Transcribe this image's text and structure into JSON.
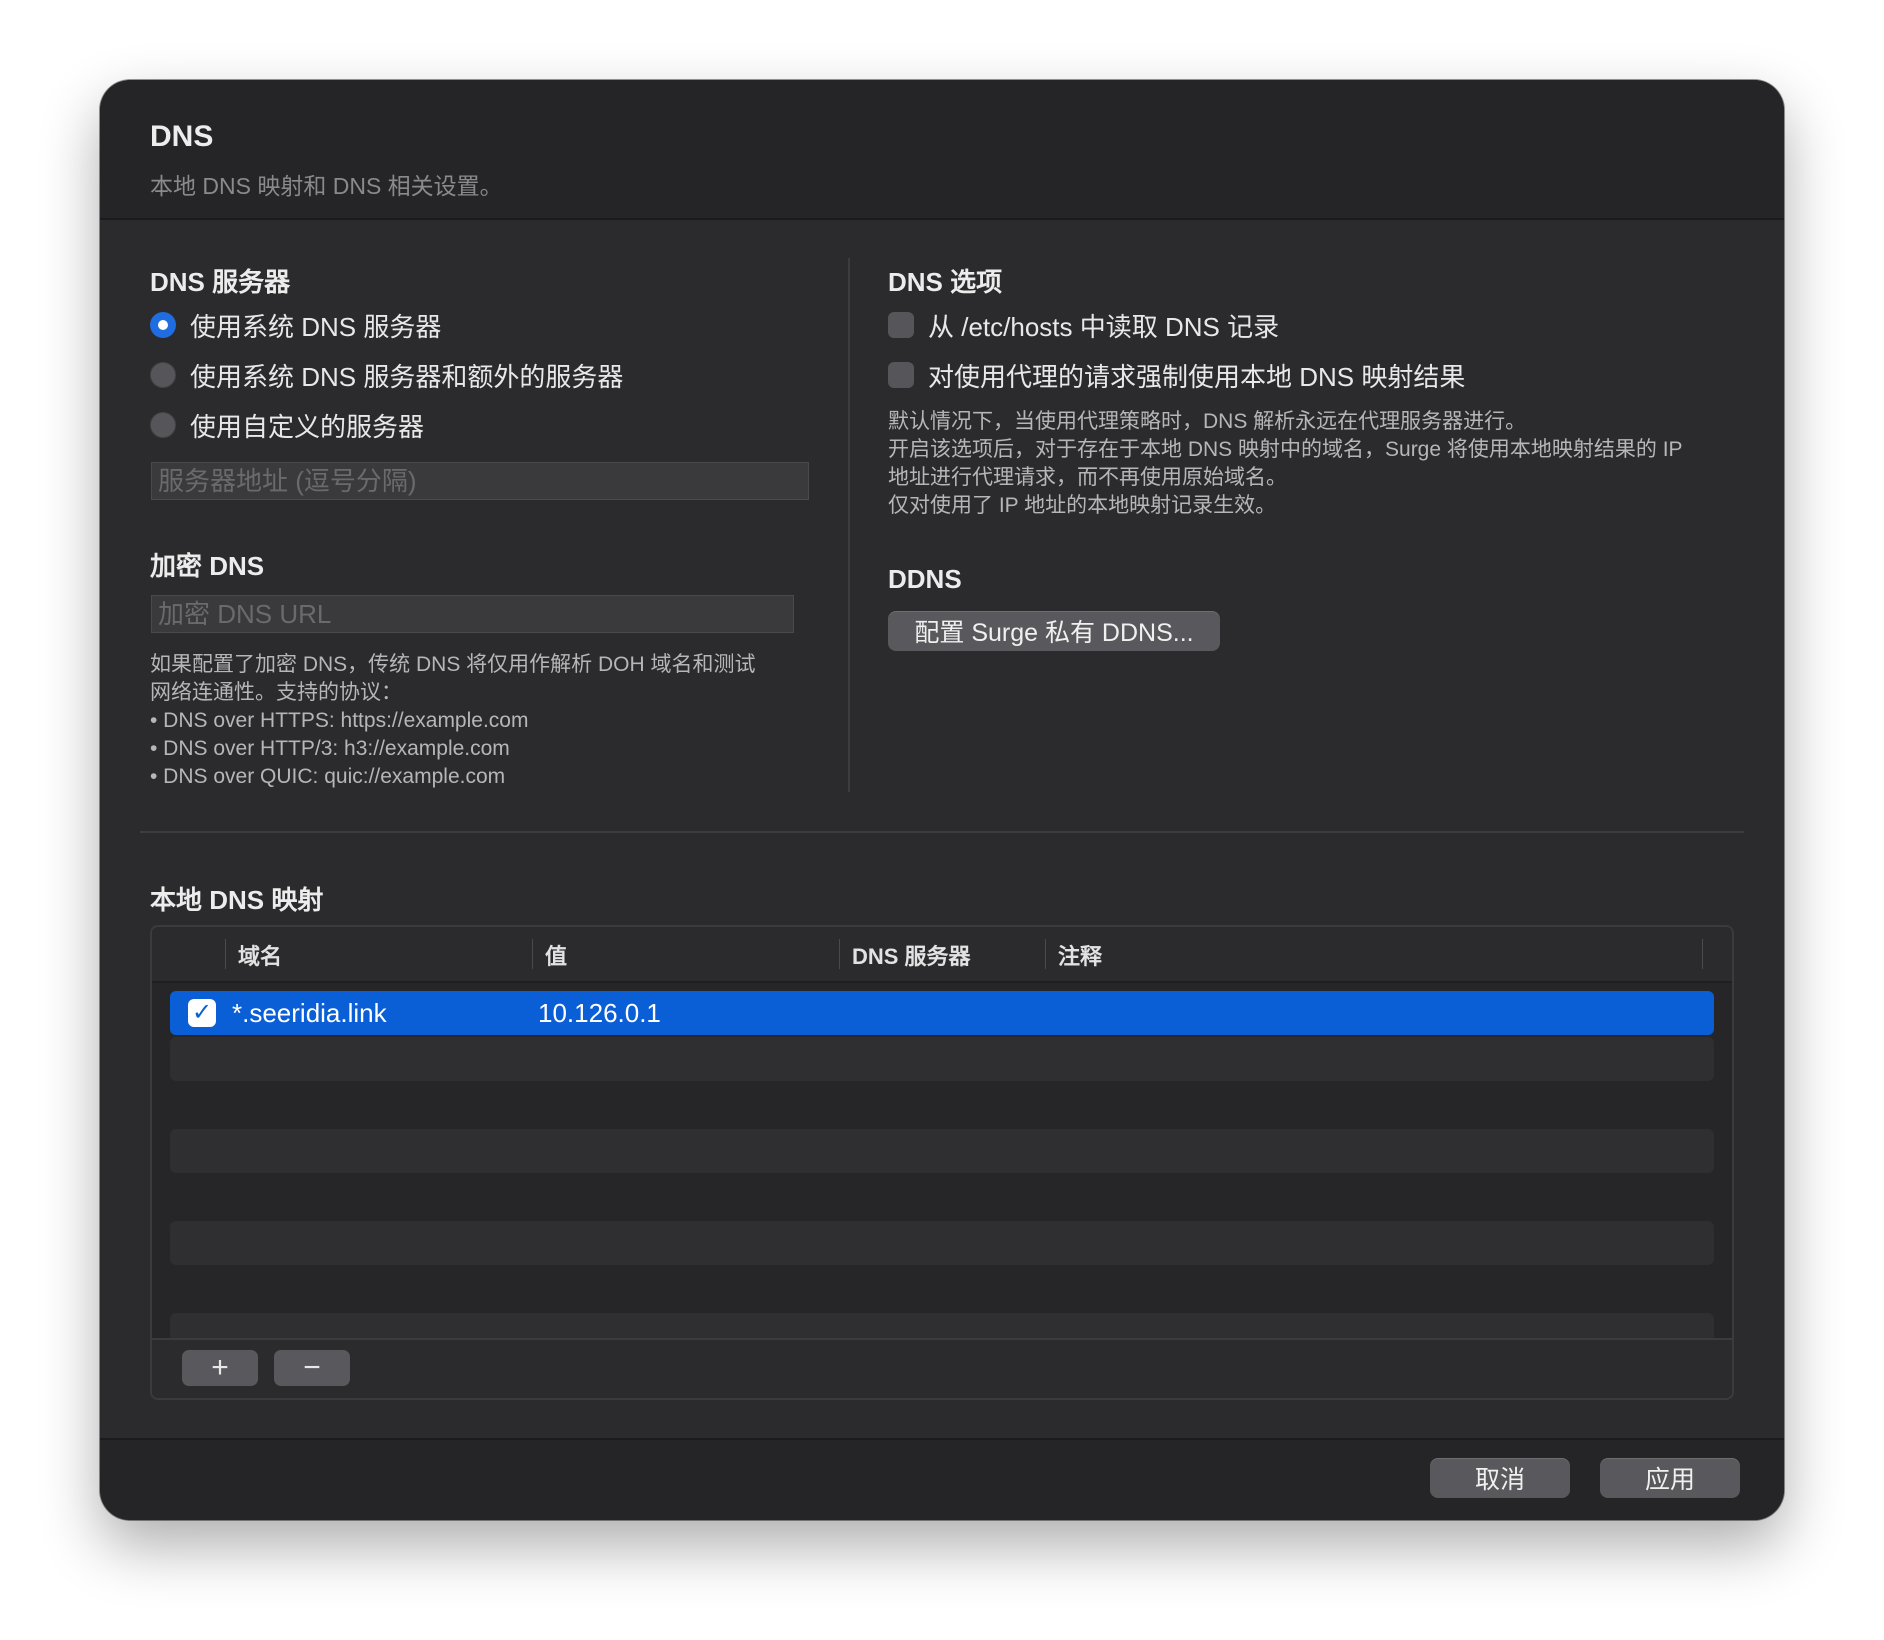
{
  "header": {
    "title": "DNS",
    "subtitle": "本地 DNS 映射和 DNS 相关设置。"
  },
  "dns_servers": {
    "title": "DNS 服务器",
    "options": [
      {
        "label": "使用系统 DNS 服务器",
        "selected": true
      },
      {
        "label": "使用系统 DNS 服务器和额外的服务器",
        "selected": false
      },
      {
        "label": "使用自定义的服务器",
        "selected": false
      }
    ],
    "address_placeholder": "服务器地址 (逗号分隔)"
  },
  "encrypted_dns": {
    "title": "加密 DNS",
    "url_placeholder": "加密 DNS URL",
    "help_lines": [
      "如果配置了加密 DNS，传统 DNS 将仅用作解析 DOH 域名和测试",
      "网络连通性。支持的协议：",
      "• DNS over HTTPS: https://example.com",
      "• DNS over HTTP/3: h3://example.com",
      "• DNS over QUIC: quic://example.com"
    ]
  },
  "dns_options": {
    "title": "DNS 选项",
    "checkboxes": [
      {
        "label": "从 /etc/hosts 中读取 DNS 记录",
        "checked": false
      },
      {
        "label": "对使用代理的请求强制使用本地 DNS 映射结果",
        "checked": false
      }
    ],
    "help_lines": [
      "默认情况下，当使用代理策略时，DNS 解析永远在代理服务器进行。",
      "开启该选项后，对于存在于本地 DNS 映射中的域名，Surge 将使用本地映射结果的 IP",
      "地址进行代理请求，而不再使用原始域名。",
      "仅对使用了 IP 地址的本地映射记录生效。"
    ]
  },
  "ddns": {
    "title": "DDNS",
    "button_label": "配置 Surge 私有 DDNS..."
  },
  "local_mapping": {
    "title": "本地 DNS 映射",
    "columns": [
      "域名",
      "值",
      "DNS 服务器",
      "注释"
    ],
    "rows": [
      {
        "enabled": true,
        "domain": "*.seeridia.link",
        "value": "10.126.0.1",
        "dns_server": "",
        "comment": ""
      }
    ],
    "add_label": "+",
    "remove_label": "−"
  },
  "footer": {
    "cancel_label": "取消",
    "apply_label": "应用"
  },
  "colors": {
    "accent": "#0a5ed6",
    "window_bg": "#2b2b2d",
    "button_bg": "#59595d"
  },
  "icons": {
    "checkmark": "checkmark-icon"
  }
}
